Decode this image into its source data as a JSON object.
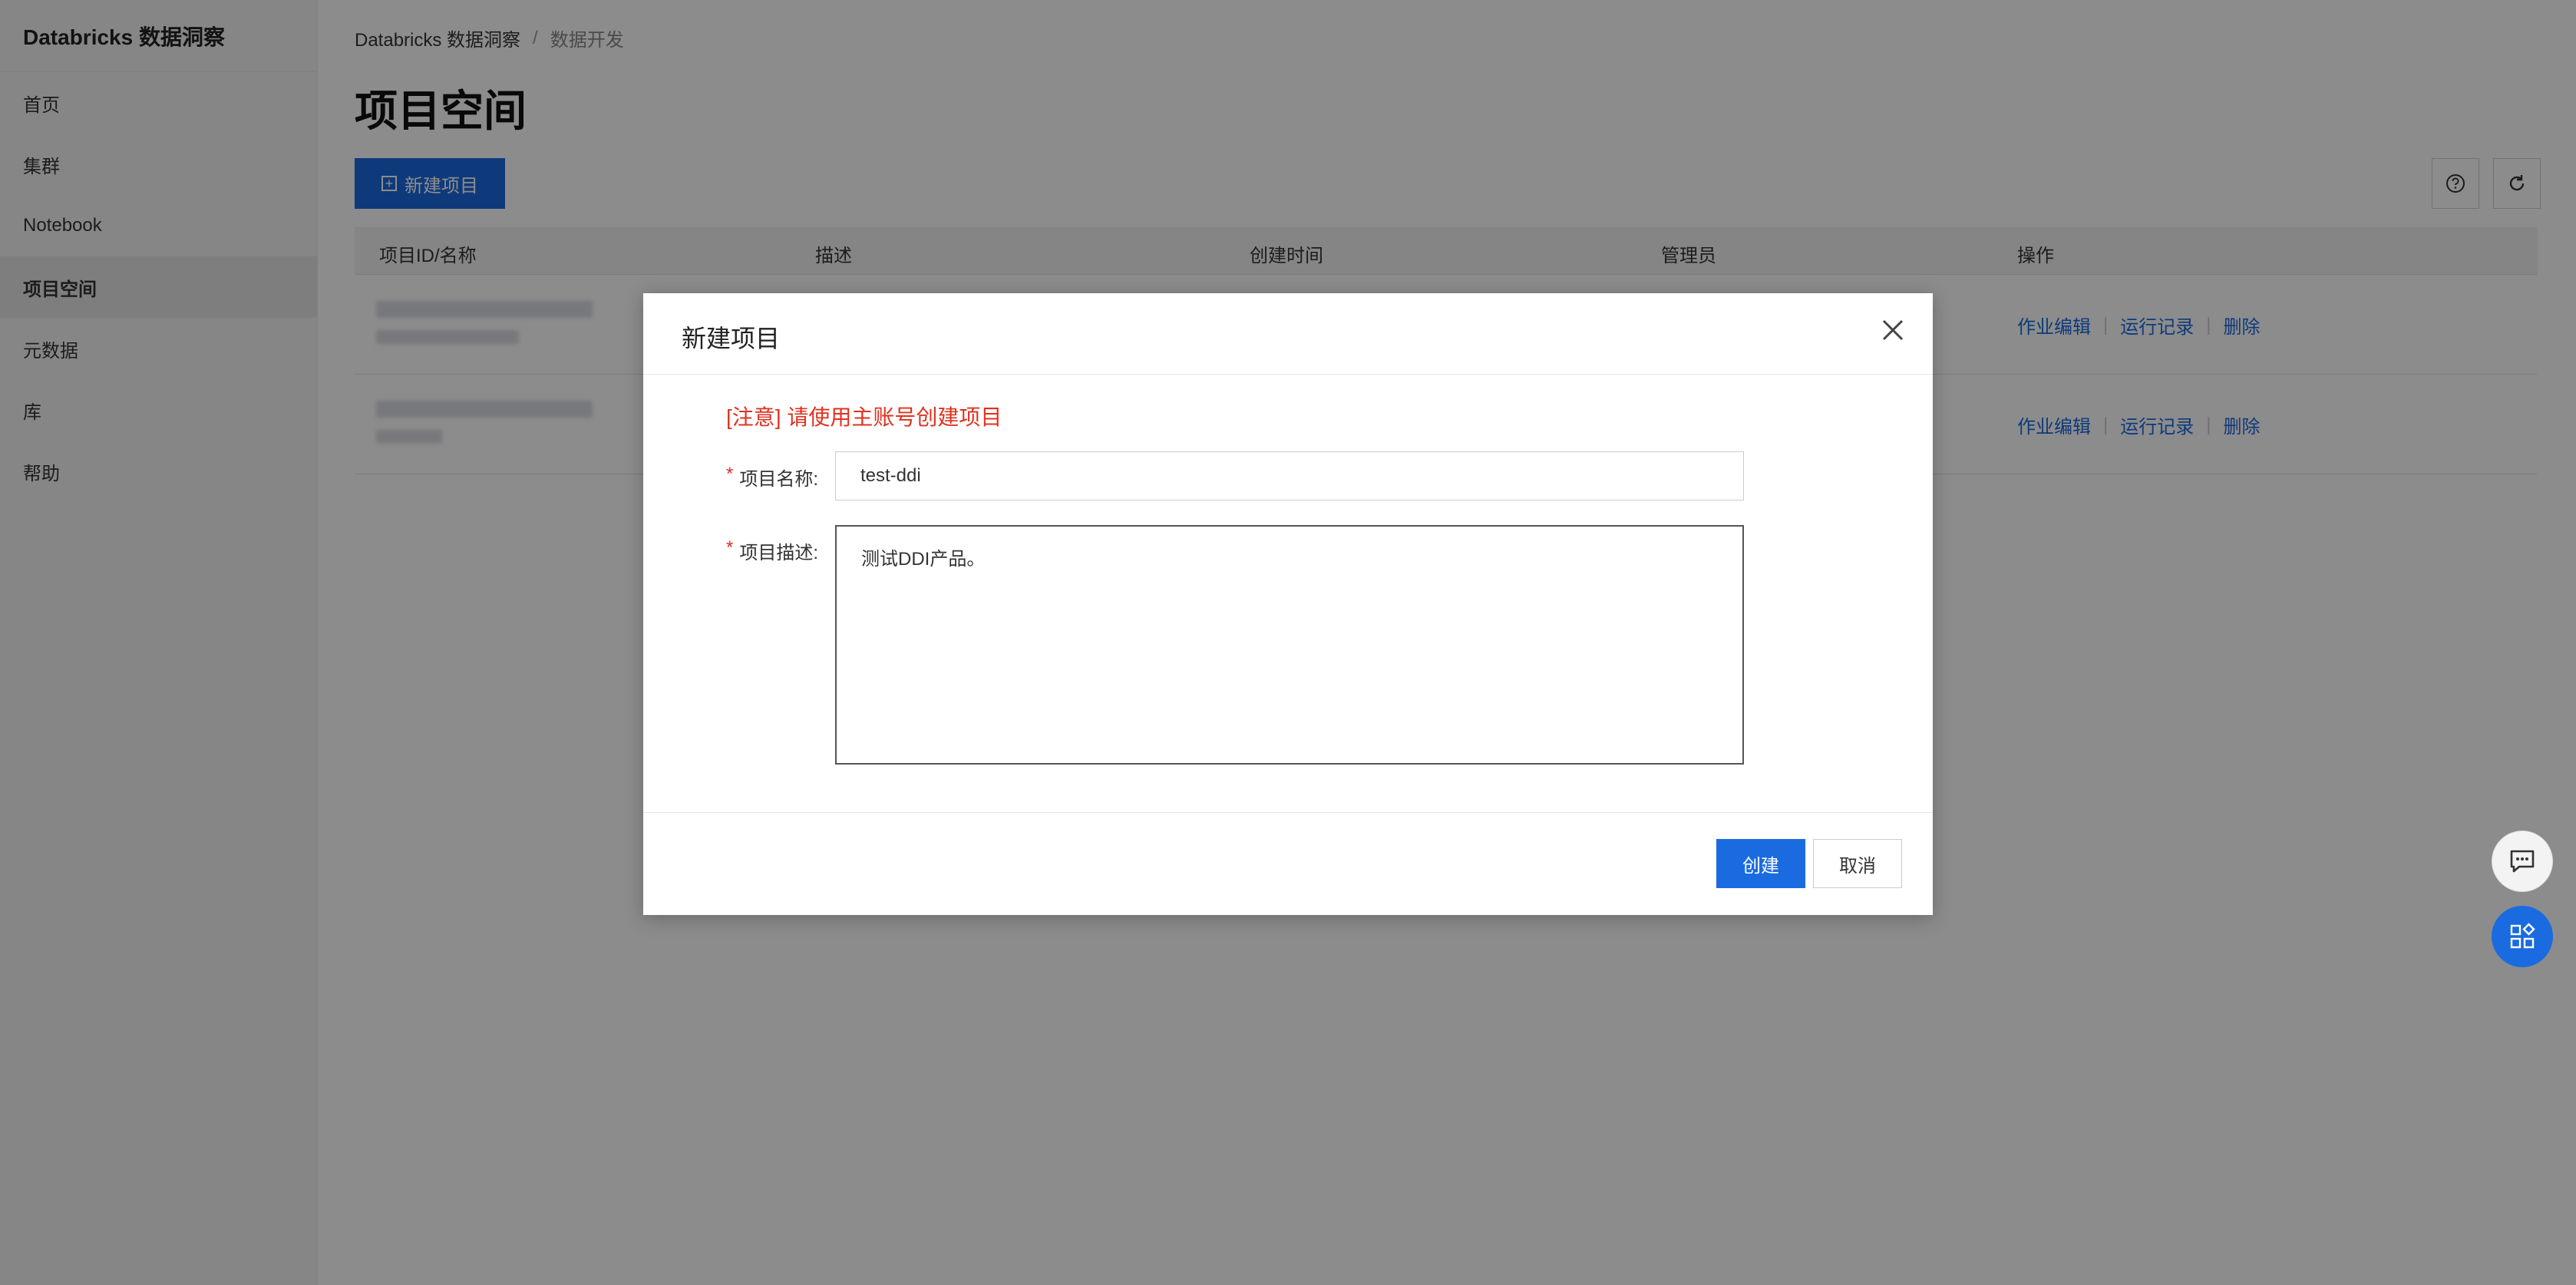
{
  "app": {
    "brand": "Databricks 数据洞察"
  },
  "sidebar": {
    "items": [
      {
        "label": "首页"
      },
      {
        "label": "集群"
      },
      {
        "label": "Notebook"
      },
      {
        "label": "项目空间",
        "active": true
      },
      {
        "label": "元数据"
      },
      {
        "label": "库"
      },
      {
        "label": "帮助"
      }
    ]
  },
  "breadcrumb": {
    "root": "Databricks 数据洞察",
    "separator": "/",
    "current": "数据开发"
  },
  "page": {
    "title": "项目空间",
    "new_button": "新建项目"
  },
  "table": {
    "columns": [
      "项目ID/名称",
      "描述",
      "创建时间",
      "管理员",
      "操作"
    ],
    "rows": [
      {
        "actions": [
          "作业编辑",
          "运行记录",
          "删除"
        ]
      },
      {
        "actions": [
          "作业编辑",
          "运行记录",
          "删除"
        ]
      }
    ]
  },
  "dialog": {
    "title": "新建项目",
    "notice": "[注意] 请使用主账号创建项目",
    "required_mark": "*",
    "name_label": "项目名称:",
    "name_value": "test-ddi",
    "desc_label": "项目描述:",
    "desc_value": "测试DDI产品。",
    "create_button": "创建",
    "cancel_button": "取消"
  },
  "icons": {
    "help": "question-circle-icon",
    "refresh": "refresh-icon",
    "close": "close-icon",
    "chat": "chat-bubble-icon",
    "apps": "apps-grid-icon"
  },
  "colors": {
    "primary": "#1a6be0",
    "danger": "#e0321f"
  }
}
